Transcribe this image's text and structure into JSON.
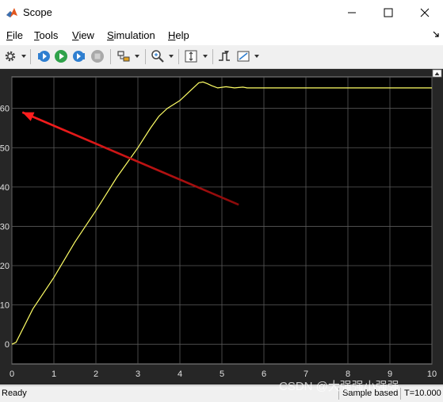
{
  "window": {
    "title": "Scope"
  },
  "menu": [
    "File",
    "Tools",
    "View",
    "Simulation",
    "Help"
  ],
  "menu_mnemonic": [
    "F",
    "T",
    "V",
    "S",
    "H"
  ],
  "toolbar_icons": [
    "gear-icon",
    "step-back-icon",
    "run-icon",
    "step-forward-icon",
    "stop-icon",
    "highlight-icon",
    "zoom-icon",
    "autoscale-icon",
    "trigger-icon",
    "measure-icon"
  ],
  "status": {
    "ready": "Ready",
    "mode": "Sample based",
    "time": "T=10.000"
  },
  "watermark": "CSDN @大强强小强强",
  "colors": {
    "background": "#000000",
    "signal": "#ffff66",
    "grid": "#5a5a5a",
    "arrow": "#ff1e1e",
    "tick_text": "#e0e0e0"
  },
  "chart_data": {
    "type": "line",
    "xlim": [
      0,
      10
    ],
    "ylim": [
      -5,
      68
    ],
    "xticks": [
      0,
      1,
      2,
      3,
      4,
      5,
      6,
      7,
      8,
      9,
      10
    ],
    "yticks": [
      0,
      10,
      20,
      30,
      40,
      50,
      60
    ],
    "grid": true,
    "series": [
      {
        "x": [
          0,
          0.1,
          0.5,
          1,
          1.5,
          2,
          2.5,
          3,
          3.3,
          3.5,
          3.7,
          4,
          4.2,
          4.35,
          4.45,
          4.55,
          4.65,
          4.75,
          4.9,
          5.1,
          5.3,
          5.5,
          5.6,
          10
        ],
        "y": [
          0,
          0.5,
          9,
          17,
          26,
          34,
          42.5,
          50,
          55,
          58,
          60,
          62,
          64,
          65.5,
          66.5,
          66.7,
          66.3,
          65.8,
          65.2,
          65.5,
          65.2,
          65.4,
          65.2,
          65.2
        ]
      }
    ],
    "annotation_arrow": {
      "from": [
        5.4,
        35.5
      ],
      "to": [
        0.25,
        59
      ]
    }
  }
}
